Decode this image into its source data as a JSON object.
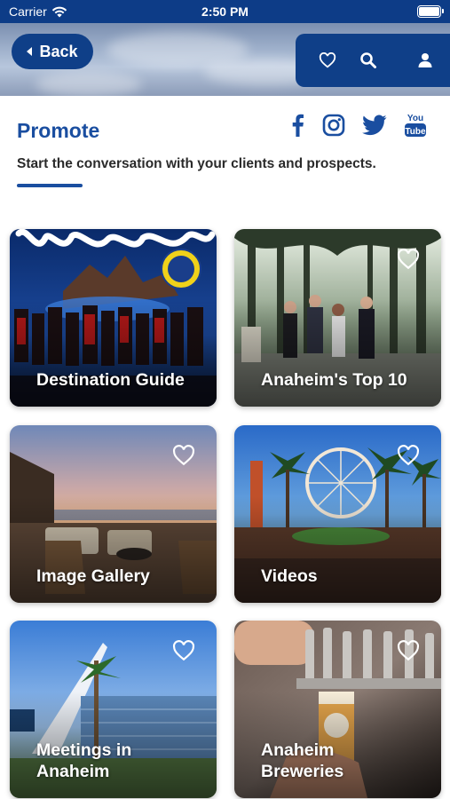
{
  "status_bar": {
    "carrier": "Carrier",
    "time": "2:50 PM"
  },
  "header": {
    "back_label": "Back"
  },
  "section": {
    "title": "Promote",
    "subtitle": "Start the conversation with your clients and prospects."
  },
  "social": [
    "facebook-icon",
    "instagram-icon",
    "twitter-icon",
    "youtube-icon"
  ],
  "cards": [
    {
      "label": "Destination Guide",
      "favorite_visible": false
    },
    {
      "label": "Anaheim's Top 10",
      "favorite_visible": true
    },
    {
      "label": "Image Gallery",
      "favorite_visible": true
    },
    {
      "label": "Videos",
      "favorite_visible": true
    },
    {
      "label": "Meetings in Anaheim",
      "favorite_visible": true
    },
    {
      "label": "Anaheim Breweries",
      "favorite_visible": true
    }
  ],
  "colors": {
    "brand": "#0f3f88",
    "accent": "#1a4ea0"
  }
}
